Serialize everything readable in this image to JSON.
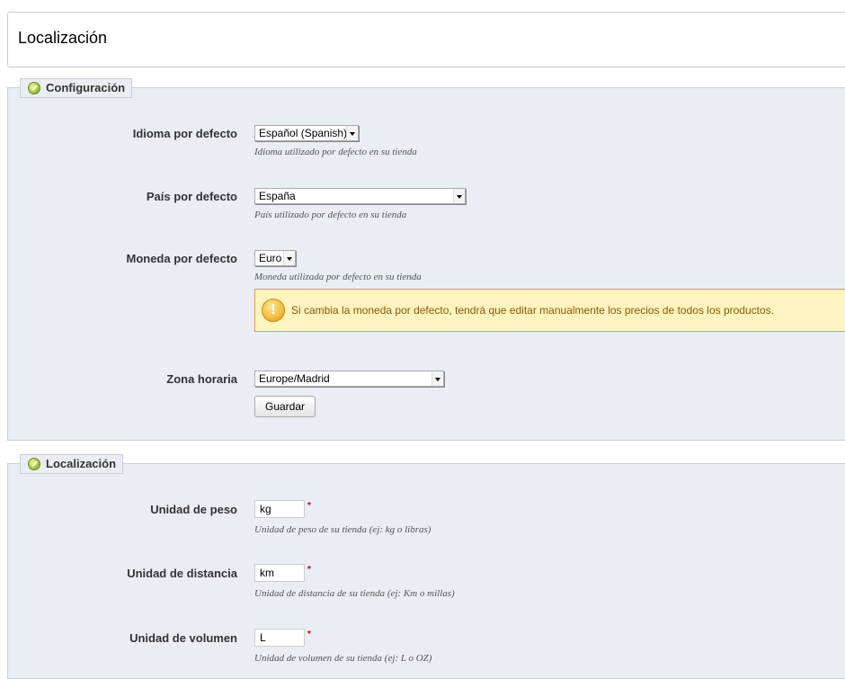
{
  "page": {
    "title": "Localización"
  },
  "config": {
    "legend": "Configuración",
    "language": {
      "label": "Idioma por defecto",
      "value": "Español (Spanish)",
      "hint": "Idioma utilizado por defecto en su tienda"
    },
    "country": {
      "label": "País por defecto",
      "value": "España",
      "hint": "País utilizado por defecto en su tienda"
    },
    "currency": {
      "label": "Moneda por defecto",
      "value": "Euro",
      "hint": "Moneda utilizada por defecto en su tienda"
    },
    "warning": {
      "icon": "warning-icon",
      "text": "Si cambia la moneda por defecto, tendrá que editar manualmente los precios de todos los productos."
    },
    "timezone": {
      "label": "Zona horaria",
      "value": "Europe/Madrid"
    },
    "save_label": "Guardar"
  },
  "localization": {
    "legend": "Localización",
    "weight": {
      "label": "Unidad de peso",
      "value": "kg",
      "hint": "Unidad de peso de su tienda (ej: kg o libras)"
    },
    "distance": {
      "label": "Unidad de distancia",
      "value": "km",
      "hint": "Unidad de distancia de su tienda (ej: Km o millas)"
    },
    "volume": {
      "label": "Unidad de volumen",
      "value": "L",
      "hint": "Unidad de volumen de su tienda (ej: L o OZ)"
    },
    "required_mark": "*"
  },
  "colors": {
    "panel_bg": "#ebedf4",
    "panel_border": "#ccced7",
    "warning_bg": "#fff3c0",
    "warning_border": "#d6a13c",
    "required": "#cc0000"
  }
}
